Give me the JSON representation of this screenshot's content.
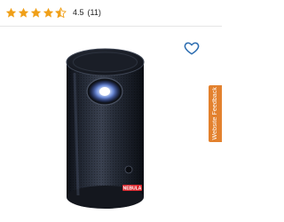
{
  "rating": {
    "value": "4.5",
    "count": "(11)",
    "stars_filled": 4.5,
    "stars_total": 5,
    "star_color": "#f0a019"
  },
  "product": {
    "badge_text": "NEBULA",
    "body_color": "#202530",
    "lens_glow_color": "#cfe0ff",
    "badge_color": "#d8282e"
  },
  "wishlist": {
    "icon": "heart-outline-icon",
    "color": "#2b6cb0"
  },
  "feedback": {
    "label": "Website Feedback",
    "color": "#e3812e"
  }
}
